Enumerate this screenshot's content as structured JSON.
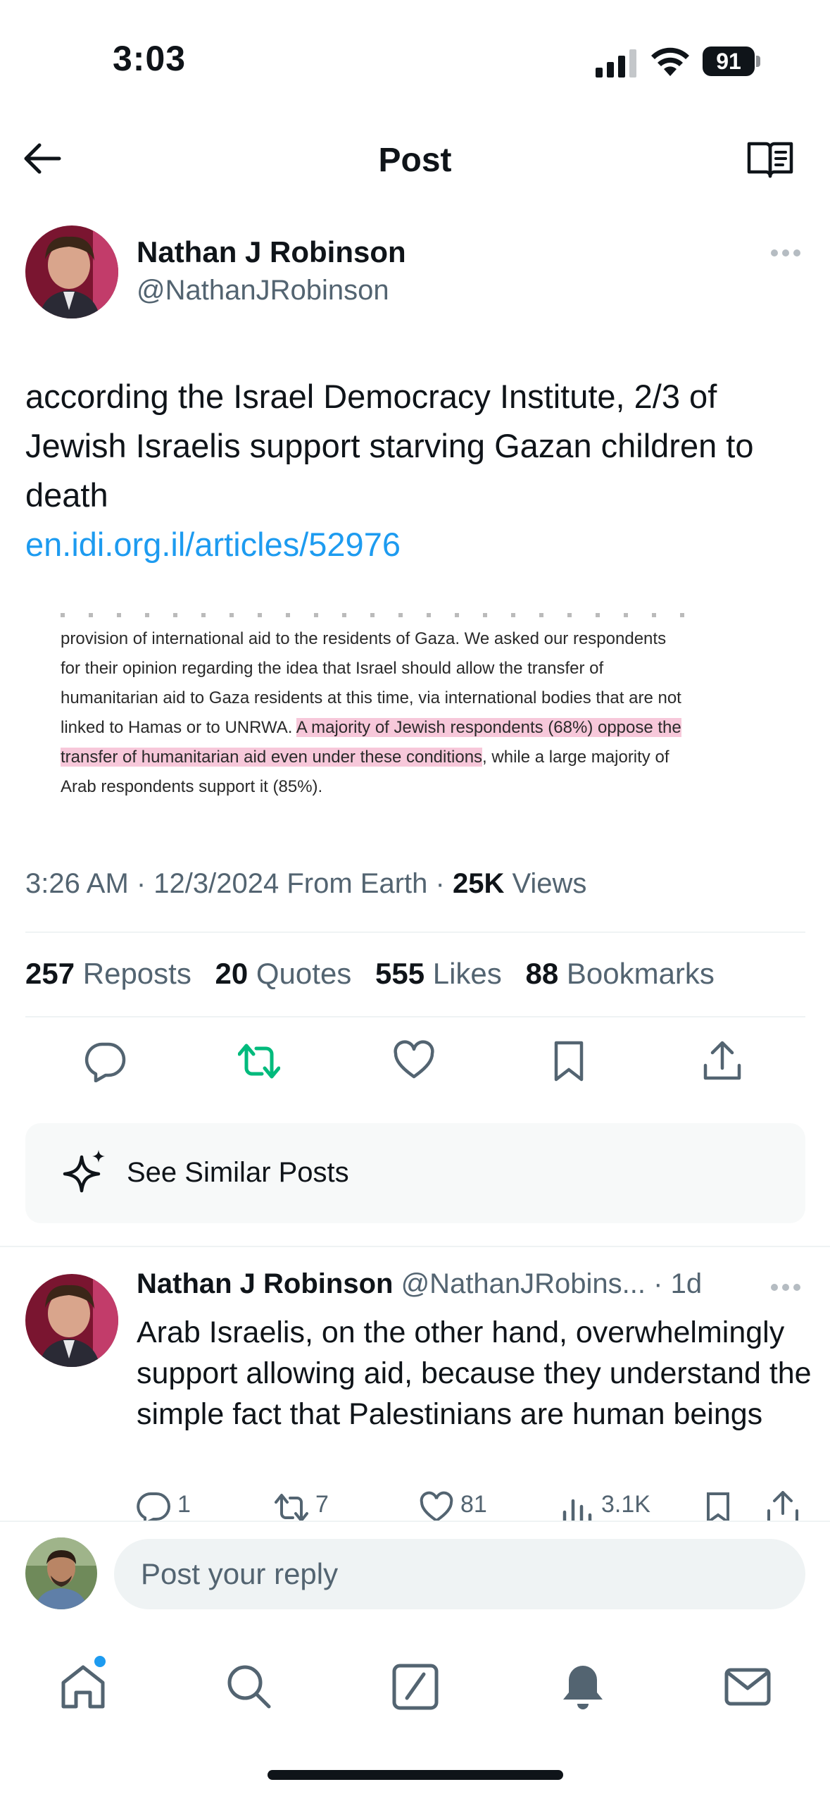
{
  "status_bar": {
    "time": "3:03",
    "battery": "91",
    "icons": [
      "cellular-signal-icon",
      "wifi-icon",
      "battery-icon"
    ]
  },
  "header": {
    "title": "Post",
    "icons": [
      "back-arrow-icon",
      "reader-mode-icon"
    ]
  },
  "post": {
    "author_name": "Nathan J Robinson",
    "author_handle": "@NathanJRobinson",
    "text": "according the Israel Democracy Institute, 2/3 of Jewish Israelis support starving Gazan children to death",
    "link": "en.idi.org.il/articles/52976",
    "image_text": {
      "line1": "provision of international aid to the residents of Gaza. We asked our respondents",
      "line2": "for their opinion regarding the idea that Israel should allow the transfer of",
      "line3": "humanitarian aid to Gaza residents at this time, via international bodies that are not",
      "line4_pre": "linked to Hamas or to UNRWA. ",
      "line4_hl": "A majority of Jewish respondents (68%) oppose the",
      "line5_hl": "transfer of humanitarian aid even under these conditions",
      "line5_post": ", while a large majority of",
      "line6": "Arab respondents support it (85%)."
    },
    "meta": {
      "time_date": "3:26 AM · 12/3/2024 From Earth · ",
      "views_count": "25K",
      "views_label": " Views"
    },
    "stats": {
      "reposts_count": "257",
      "reposts_label": "Reposts",
      "quotes_count": "20",
      "quotes_label": "Quotes",
      "likes_count": "555",
      "likes_label": "Likes",
      "bookmarks_count": "88",
      "bookmarks_label": "Bookmarks"
    },
    "actions": [
      "reply-icon",
      "repost-icon",
      "like-icon",
      "bookmark-icon",
      "share-icon"
    ],
    "similar_label": "See Similar Posts"
  },
  "reply": {
    "author_name": "Nathan J Robinson",
    "author_handle": "@NathanJRobins...",
    "separator": " · ",
    "time": "1d",
    "text": "Arab Israelis, on the other hand, overwhelmingly support allowing aid, because they understand the simple fact that Palestinians are human beings",
    "replies": "1",
    "reposts": "7",
    "likes": "81",
    "views": "3.1K"
  },
  "reply_bar": {
    "placeholder": "Post your reply"
  },
  "tab_bar": {
    "tabs": [
      "home-icon",
      "search-icon",
      "compose-icon",
      "notifications-icon",
      "messages-icon"
    ]
  },
  "colors": {
    "accent": "#1d9bf0",
    "repost_active": "#00ba7c",
    "secondary_text": "#536471",
    "highlight": "#f7c8da"
  }
}
